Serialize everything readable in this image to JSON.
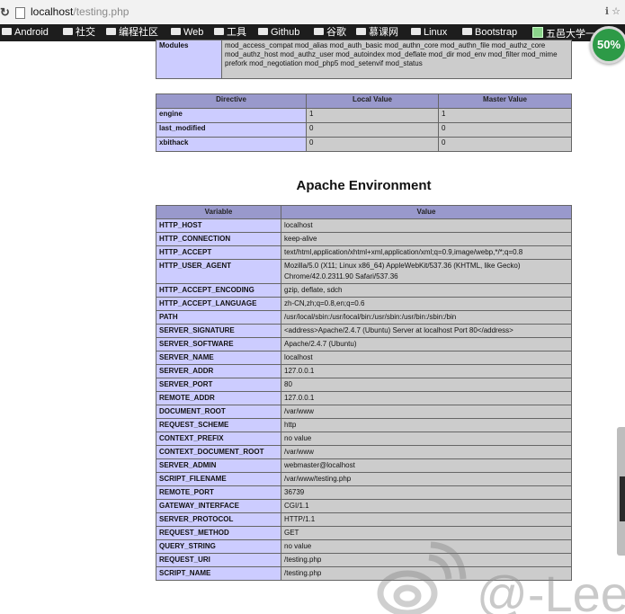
{
  "browser": {
    "url_host": "localhost",
    "url_path": "/testing.php",
    "right_glyph": "ℹ ☆",
    "bookmarks": [
      {
        "label": "Android",
        "icon": "folder-icon"
      },
      {
        "label": "社交",
        "icon": "folder-icon"
      },
      {
        "label": "编程社区",
        "icon": "folder-icon"
      },
      {
        "label": "Web",
        "icon": "folder-icon"
      },
      {
        "label": "工具",
        "icon": "folder-icon"
      },
      {
        "label": "Github",
        "icon": "folder-icon"
      },
      {
        "label": "谷歌",
        "icon": "folder-icon"
      },
      {
        "label": "慕课网",
        "icon": "folder-icon"
      },
      {
        "label": "Linux",
        "icon": "folder-icon"
      },
      {
        "label": "Bootstrap",
        "icon": "folder-icon"
      },
      {
        "label": "五邑大学一",
        "icon": "calendar-icon"
      }
    ],
    "zoom": "50%"
  },
  "modules_row": {
    "label": "Modules",
    "value": "mod_access_compat mod_alias mod_auth_basic mod_authn_core mod_authn_file mod_authz_core mod_authz_host mod_authz_user mod_autoindex mod_deflate mod_dir mod_env mod_filter mod_mime prefork mod_negotiation mod_php5 mod_setenvif mod_status"
  },
  "directive_table": {
    "headers": [
      "Directive",
      "Local Value",
      "Master Value"
    ],
    "rows": [
      {
        "name": "engine",
        "local": "1",
        "master": "1"
      },
      {
        "name": "last_modified",
        "local": "0",
        "master": "0"
      },
      {
        "name": "xbithack",
        "local": "0",
        "master": "0"
      }
    ]
  },
  "apache_env": {
    "title": "Apache Environment",
    "headers": [
      "Variable",
      "Value"
    ],
    "rows": [
      {
        "name": "HTTP_HOST",
        "value": "localhost"
      },
      {
        "name": "HTTP_CONNECTION",
        "value": "keep-alive"
      },
      {
        "name": "HTTP_ACCEPT",
        "value": "text/html,application/xhtml+xml,application/xml;q=0.9,image/webp,*/*;q=0.8"
      },
      {
        "name": "HTTP_USER_AGENT",
        "value": "Mozilla/5.0 (X11; Linux x86_64) AppleWebKit/537.36 (KHTML, like Gecko) Chrome/42.0.2311.90 Safari/537.36"
      },
      {
        "name": "HTTP_ACCEPT_ENCODING",
        "value": "gzip, deflate, sdch"
      },
      {
        "name": "HTTP_ACCEPT_LANGUAGE",
        "value": "zh-CN,zh;q=0.8,en;q=0.6"
      },
      {
        "name": "PATH",
        "value": "/usr/local/sbin:/usr/local/bin:/usr/sbin:/usr/bin:/sbin:/bin"
      },
      {
        "name": "SERVER_SIGNATURE",
        "value": "<address>Apache/2.4.7 (Ubuntu) Server at localhost Port 80</address>"
      },
      {
        "name": "SERVER_SOFTWARE",
        "value": "Apache/2.4.7 (Ubuntu)"
      },
      {
        "name": "SERVER_NAME",
        "value": "localhost"
      },
      {
        "name": "SERVER_ADDR",
        "value": "127.0.0.1"
      },
      {
        "name": "SERVER_PORT",
        "value": "80"
      },
      {
        "name": "REMOTE_ADDR",
        "value": "127.0.0.1"
      },
      {
        "name": "DOCUMENT_ROOT",
        "value": "/var/www"
      },
      {
        "name": "REQUEST_SCHEME",
        "value": "http"
      },
      {
        "name": "CONTEXT_PREFIX",
        "value": "no value"
      },
      {
        "name": "CONTEXT_DOCUMENT_ROOT",
        "value": "/var/www"
      },
      {
        "name": "SERVER_ADMIN",
        "value": "webmaster@localhost"
      },
      {
        "name": "SCRIPT_FILENAME",
        "value": "/var/www/testing.php"
      },
      {
        "name": "REMOTE_PORT",
        "value": "36739"
      },
      {
        "name": "GATEWAY_INTERFACE",
        "value": "CGI/1.1"
      },
      {
        "name": "SERVER_PROTOCOL",
        "value": "HTTP/1.1"
      },
      {
        "name": "REQUEST_METHOD",
        "value": "GET"
      },
      {
        "name": "QUERY_STRING",
        "value": "no value"
      },
      {
        "name": "REQUEST_URI",
        "value": "/testing.php"
      },
      {
        "name": "SCRIPT_NAME",
        "value": "/testing.php"
      }
    ]
  },
  "watermark": {
    "text": "@-Lee",
    "icon": "weibo-logo-icon"
  },
  "colors": {
    "header": "#9999cc",
    "label_cell": "#ccccff",
    "value_cell": "#cccccc",
    "zoom_badge": "#2d9a47"
  }
}
